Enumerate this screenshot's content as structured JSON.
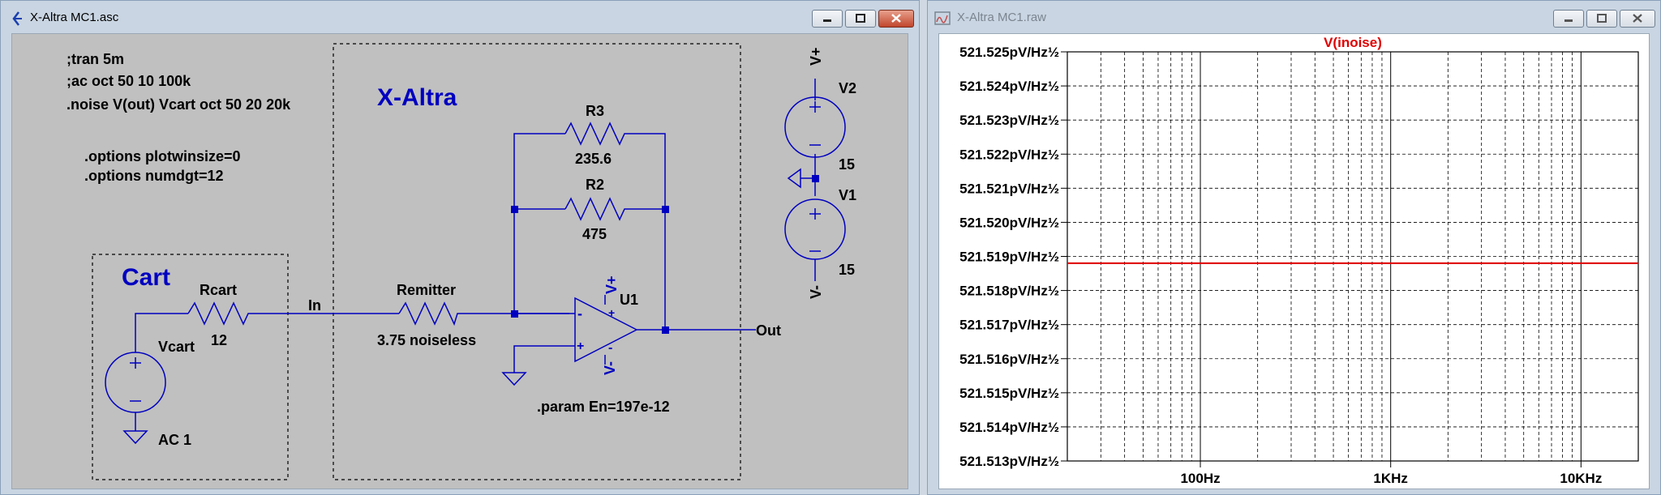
{
  "left_window": {
    "title": "X-Altra MC1.asc",
    "directives": {
      "line1": ";tran 5m",
      "line2": ";ac oct 50 10 100k",
      "line3": ".noise V(out) Vcart oct 50 20 20k",
      "line4": ".options plotwinsize=0",
      "line5": ".options numdgt=12"
    },
    "box_xaltra_label": "X-Altra",
    "box_cart_label": "Cart",
    "components": {
      "r3_name": "R3",
      "r3_value": "235.6",
      "r2_name": "R2",
      "r2_value": "475",
      "rcart_name": "Rcart",
      "rcart_value": "12",
      "remitter_name": "Remitter",
      "remitter_value": "3.75 noiseless",
      "u1_name": "U1",
      "vcart_name": "Vcart",
      "vcart_value": "AC 1",
      "v2_name": "V2",
      "v2_value": "15",
      "v1_name": "V1",
      "v1_value": "15",
      "param": ".param En=197e-12"
    },
    "nets": {
      "in": "In",
      "out": "Out",
      "vplus": "V+",
      "vminus": "V-",
      "opamp_plus": "+",
      "opamp_minus": "-"
    }
  },
  "right_window": {
    "title": "X-Altra MC1.raw",
    "trace_label": "V(inoise)"
  },
  "chart_data": {
    "type": "line",
    "title": "V(inoise)",
    "x_scale": "log",
    "xlim": [
      20,
      20000
    ],
    "ylim": [
      521.513,
      521.525
    ],
    "y_tick_values": [
      521.525,
      521.524,
      521.523,
      521.522,
      521.521,
      521.52,
      521.519,
      521.518,
      521.517,
      521.516,
      521.515,
      521.514,
      521.513
    ],
    "y_tick_labels": [
      "521.525pV/Hz½",
      "521.524pV/Hz½",
      "521.523pV/Hz½",
      "521.522pV/Hz½",
      "521.521pV/Hz½",
      "521.520pV/Hz½",
      "521.519pV/Hz½",
      "521.518pV/Hz½",
      "521.517pV/Hz½",
      "521.516pV/Hz½",
      "521.515pV/Hz½",
      "521.514pV/Hz½",
      "521.513pV/Hz½"
    ],
    "x_tick_values": [
      100,
      1000,
      10000
    ],
    "x_tick_labels": [
      "100Hz",
      "1KHz",
      "10KHz"
    ],
    "grid": true,
    "series": [
      {
        "name": "V(inoise)",
        "color": "#e00000",
        "x": [
          20,
          20000
        ],
        "y": [
          521.5188,
          521.5188
        ]
      }
    ]
  },
  "colors": {
    "schematic_blue": "#0000c0",
    "schematic_bg": "#c0c0c0",
    "trace_red": "#e00000"
  }
}
